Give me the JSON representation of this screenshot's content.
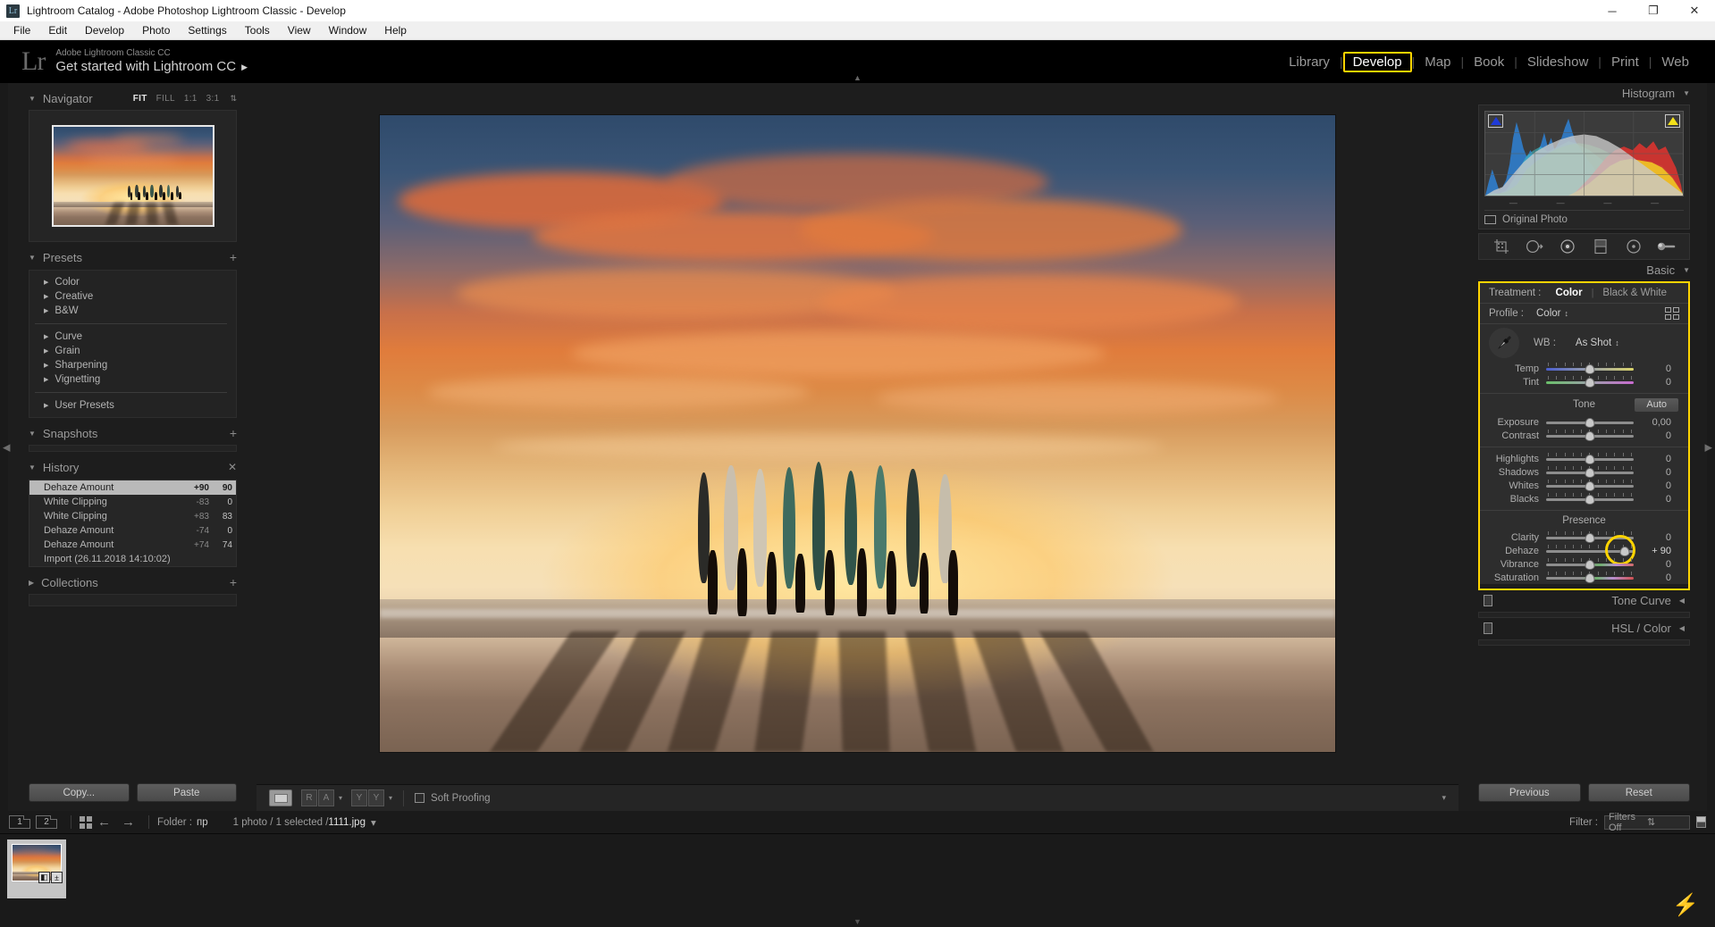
{
  "window": {
    "title": "Lightroom Catalog - Adobe Photoshop Lightroom Classic - Develop",
    "app_badge": "Lr",
    "minimize": "─",
    "maximize": "❐",
    "close": "✕"
  },
  "menubar": [
    "File",
    "Edit",
    "Develop",
    "Photo",
    "Settings",
    "Tools",
    "View",
    "Window",
    "Help"
  ],
  "identity": {
    "logo": "Lr",
    "subtitle": "Adobe Lightroom Classic CC",
    "title": "Get started with Lightroom CC",
    "arrow": "▶"
  },
  "modules": {
    "items": [
      "Library",
      "Develop",
      "Map",
      "Book",
      "Slideshow",
      "Print",
      "Web"
    ],
    "selected": "Develop",
    "separator": "|"
  },
  "left_panel": {
    "navigator": {
      "title": "Navigator",
      "zoom_levels": [
        "FIT",
        "FILL",
        "1:1",
        "3:1"
      ],
      "selected_zoom": "FIT",
      "stepper": "⇅"
    },
    "presets": {
      "title": "Presets",
      "add": "+",
      "groups": [
        [
          "Color",
          "Creative",
          "B&W"
        ],
        [
          "Curve",
          "Grain",
          "Sharpening",
          "Vignetting"
        ],
        [
          "User Presets"
        ]
      ]
    },
    "snapshots": {
      "title": "Snapshots",
      "add": "+"
    },
    "history": {
      "title": "History",
      "clear": "✕",
      "rows": [
        {
          "name": "Dehaze Amount",
          "delta": "+90",
          "value": "90",
          "selected": true
        },
        {
          "name": "White Clipping",
          "delta": "-83",
          "value": "0",
          "selected": false
        },
        {
          "name": "White Clipping",
          "delta": "+83",
          "value": "83",
          "selected": false
        },
        {
          "name": "Dehaze Amount",
          "delta": "-74",
          "value": "0",
          "selected": false
        },
        {
          "name": "Dehaze Amount",
          "delta": "+74",
          "value": "74",
          "selected": false
        },
        {
          "name": "Import (26.11.2018 14:10:02)",
          "delta": "",
          "value": "",
          "selected": false
        }
      ]
    },
    "collections": {
      "title": "Collections",
      "add": "+"
    },
    "buttons": {
      "copy": "Copy...",
      "paste": "Paste"
    }
  },
  "toolbar": {
    "view_loupe": "loupe-view-icon",
    "compare_cells": [
      "R",
      "A"
    ],
    "survey_cells": [
      "Y",
      "Y"
    ],
    "caret": "▾",
    "soft_proofing": "Soft Proofing",
    "right_caret": "▾"
  },
  "right_panel": {
    "histogram": {
      "title": "Histogram",
      "tri": "▼",
      "shadow_clipping": "shadow-clipping-icon",
      "highlight_clipping": "highlight-clipping-icon",
      "ticks": [
        "—",
        "—",
        "—",
        "—"
      ],
      "original_photo": "Original Photo"
    },
    "tools": [
      "crop-overlay-icon",
      "spot-removal-icon",
      "red-eye-icon",
      "graduated-filter-icon",
      "radial-filter-icon",
      "adjustment-brush-icon"
    ],
    "basic": {
      "title": "Basic",
      "tri": "▼",
      "treatment_label": "Treatment :",
      "treatment_options": [
        "Color",
        "Black & White"
      ],
      "treatment_selected": "Color",
      "profile_label": "Profile :",
      "profile_value": "Color",
      "profile_stepper": "↕",
      "profile_browser": "profile-browser-icon",
      "wb_label": "WB :",
      "wb_value": "As Shot",
      "wb_stepper": "↕",
      "eyedropper": "white-balance-selector-icon",
      "wb_sliders": [
        {
          "name": "Temp",
          "value": "0",
          "pos": 50,
          "track": "temp"
        },
        {
          "name": "Tint",
          "value": "0",
          "pos": 50,
          "track": "tint"
        }
      ],
      "tone_label": "Tone",
      "auto_label": "Auto",
      "tone_sliders": [
        {
          "name": "Exposure",
          "value": "0,00",
          "pos": 50,
          "track": "plain",
          "ticks": false
        },
        {
          "name": "Contrast",
          "value": "0",
          "pos": 50,
          "track": "plain",
          "ticks": true
        }
      ],
      "tone_sliders2": [
        {
          "name": "Highlights",
          "value": "0",
          "pos": 50,
          "track": "plain",
          "ticks": true
        },
        {
          "name": "Shadows",
          "value": "0",
          "pos": 50,
          "track": "plain",
          "ticks": true
        },
        {
          "name": "Whites",
          "value": "0",
          "pos": 50,
          "track": "plain",
          "ticks": true
        },
        {
          "name": "Blacks",
          "value": "0",
          "pos": 50,
          "track": "plain",
          "ticks": true
        }
      ],
      "presence_label": "Presence",
      "presence_sliders": [
        {
          "name": "Clarity",
          "value": "0",
          "pos": 50,
          "track": "plain",
          "ticks": true
        },
        {
          "name": "Dehaze",
          "value": "+ 90",
          "pos": 90,
          "track": "plain",
          "ticks": true,
          "highlighted": true
        },
        {
          "name": "Vibrance",
          "value": "0",
          "pos": 50,
          "track": "vib",
          "ticks": true
        },
        {
          "name": "Saturation",
          "value": "0",
          "pos": 50,
          "track": "sat",
          "ticks": true
        }
      ]
    },
    "collapsed_panels": [
      {
        "title": "Tone Curve",
        "tri": "◀"
      },
      {
        "title": "HSL / Color",
        "tri": "◀"
      }
    ],
    "buttons": {
      "previous": "Previous",
      "reset": "Reset"
    }
  },
  "filmstrip": {
    "page_numbers": [
      "1",
      "2"
    ],
    "grid_icon": "grid-view-icon",
    "back_arrow": "←",
    "forward_arrow": "→",
    "folder_label": "Folder :",
    "folder_name": "пр",
    "status_prefix": "1 photo / 1 selected / ",
    "filename": "1111.jpg",
    "status_caret": "▾",
    "filter_label": "Filter :",
    "filter_value": "Filters Off",
    "filter_stepper": "⇅",
    "thumb_badges": [
      "◧",
      "±"
    ],
    "sync_icon": "sync-bolt-icon"
  },
  "colors": {
    "accent_yellow": "#ffd400",
    "panel_bg": "#1d1d1d",
    "section_bg": "#2d2d2d",
    "text": "#b4b4b4"
  }
}
